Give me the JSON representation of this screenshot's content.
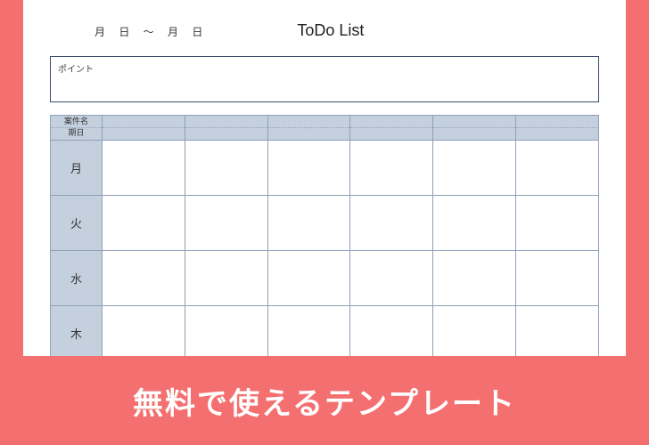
{
  "header": {
    "date_range": "月 日 ～  月 日",
    "title": "ToDo List"
  },
  "point_box": {
    "label": "ポイント"
  },
  "schedule": {
    "corner_line1": "案件名",
    "corner_line2": "期日",
    "columns": [
      "",
      "",
      "",
      "",
      "",
      ""
    ],
    "days": [
      "月",
      "火",
      "水",
      "木"
    ]
  },
  "banner": {
    "text": "無料で使えるテンプレート"
  }
}
